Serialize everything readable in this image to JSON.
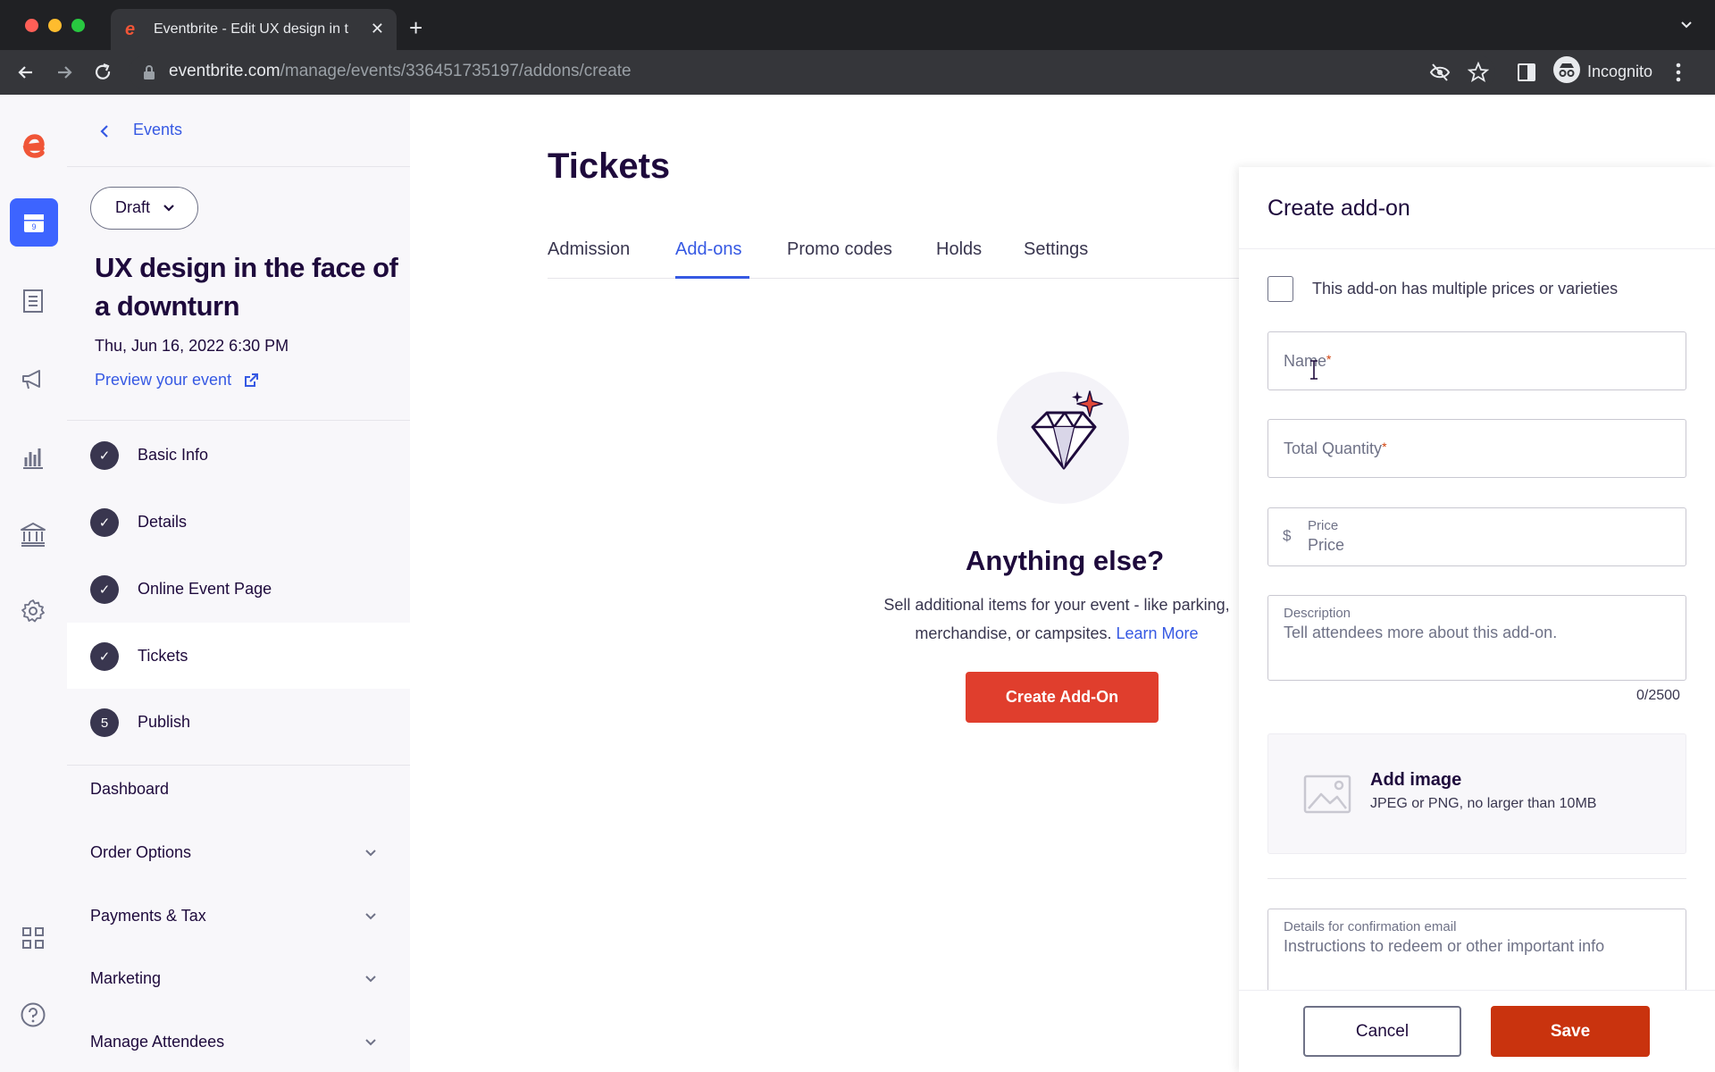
{
  "browser": {
    "tab_title": "Eventbrite - Edit UX design in t",
    "tab_close": "✕",
    "new_tab": "+",
    "url_host": "eventbrite.com",
    "url_path": "/manage/events/336451735197/addons/create",
    "incognito_label": "Incognito",
    "icons": [
      "back-icon",
      "forward-icon",
      "reload-icon",
      "lock-icon",
      "eye-off-icon",
      "star-icon",
      "sidepanel-icon",
      "incognito-icon",
      "more-icon"
    ]
  },
  "rail": {
    "icons": [
      "eventbrite-logo",
      "calendar-icon",
      "orders-icon",
      "megaphone-icon",
      "reports-icon",
      "finance-icon",
      "settings-icon",
      "apps-icon",
      "help-icon"
    ],
    "active_icon": "calendar-icon",
    "calendar_day": "9"
  },
  "sidebar": {
    "back_label": "Events",
    "status_label": "Draft",
    "event_title": "UX design in the face of a downturn",
    "event_date": "Thu, Jun 16, 2022 6:30 PM",
    "preview_label": "Preview your event",
    "steps": [
      {
        "label": "Basic Info",
        "marker": "✓"
      },
      {
        "label": "Details",
        "marker": "✓"
      },
      {
        "label": "Online Event Page",
        "marker": "✓"
      },
      {
        "label": "Tickets",
        "marker": "✓"
      },
      {
        "label": "Publish",
        "marker": "5"
      }
    ],
    "active_step": "Tickets",
    "sections": [
      "Dashboard",
      "Order Options",
      "Payments & Tax",
      "Marketing",
      "Manage Attendees"
    ]
  },
  "main": {
    "title": "Tickets",
    "tabs": [
      "Admission",
      "Add-ons",
      "Promo codes",
      "Holds",
      "Settings"
    ],
    "active_tab": "Add-ons",
    "empty_title": "Anything else?",
    "empty_desc_1": "Sell additional items for your event - like parking,",
    "empty_desc_2": "merchandise, or campsites.",
    "learn_more": "Learn More",
    "create_button": "Create Add-On"
  },
  "drawer": {
    "title": "Create add-on",
    "checkbox_label": "This add-on has multiple prices or varieties",
    "name_placeholder": "Name",
    "quantity_placeholder": "Total Quantity",
    "required_mark": "*",
    "price_label": "Price",
    "price_placeholder": "Price",
    "currency_symbol": "$",
    "description_label": "Description",
    "description_placeholder": "Tell attendees more about this add-on.",
    "description_counter": "0/2500",
    "image_title": "Add image",
    "image_sub": "JPEG or PNG, no larger than 10MB",
    "email_label": "Details for confirmation email",
    "email_placeholder": "Instructions to redeem or other important info",
    "cancel_label": "Cancel",
    "save_label": "Save"
  },
  "colors": {
    "brand": "#f05537",
    "link": "#3659e3",
    "text": "#1e0a3c",
    "save": "#c9330e",
    "create": "#e03e2d"
  }
}
